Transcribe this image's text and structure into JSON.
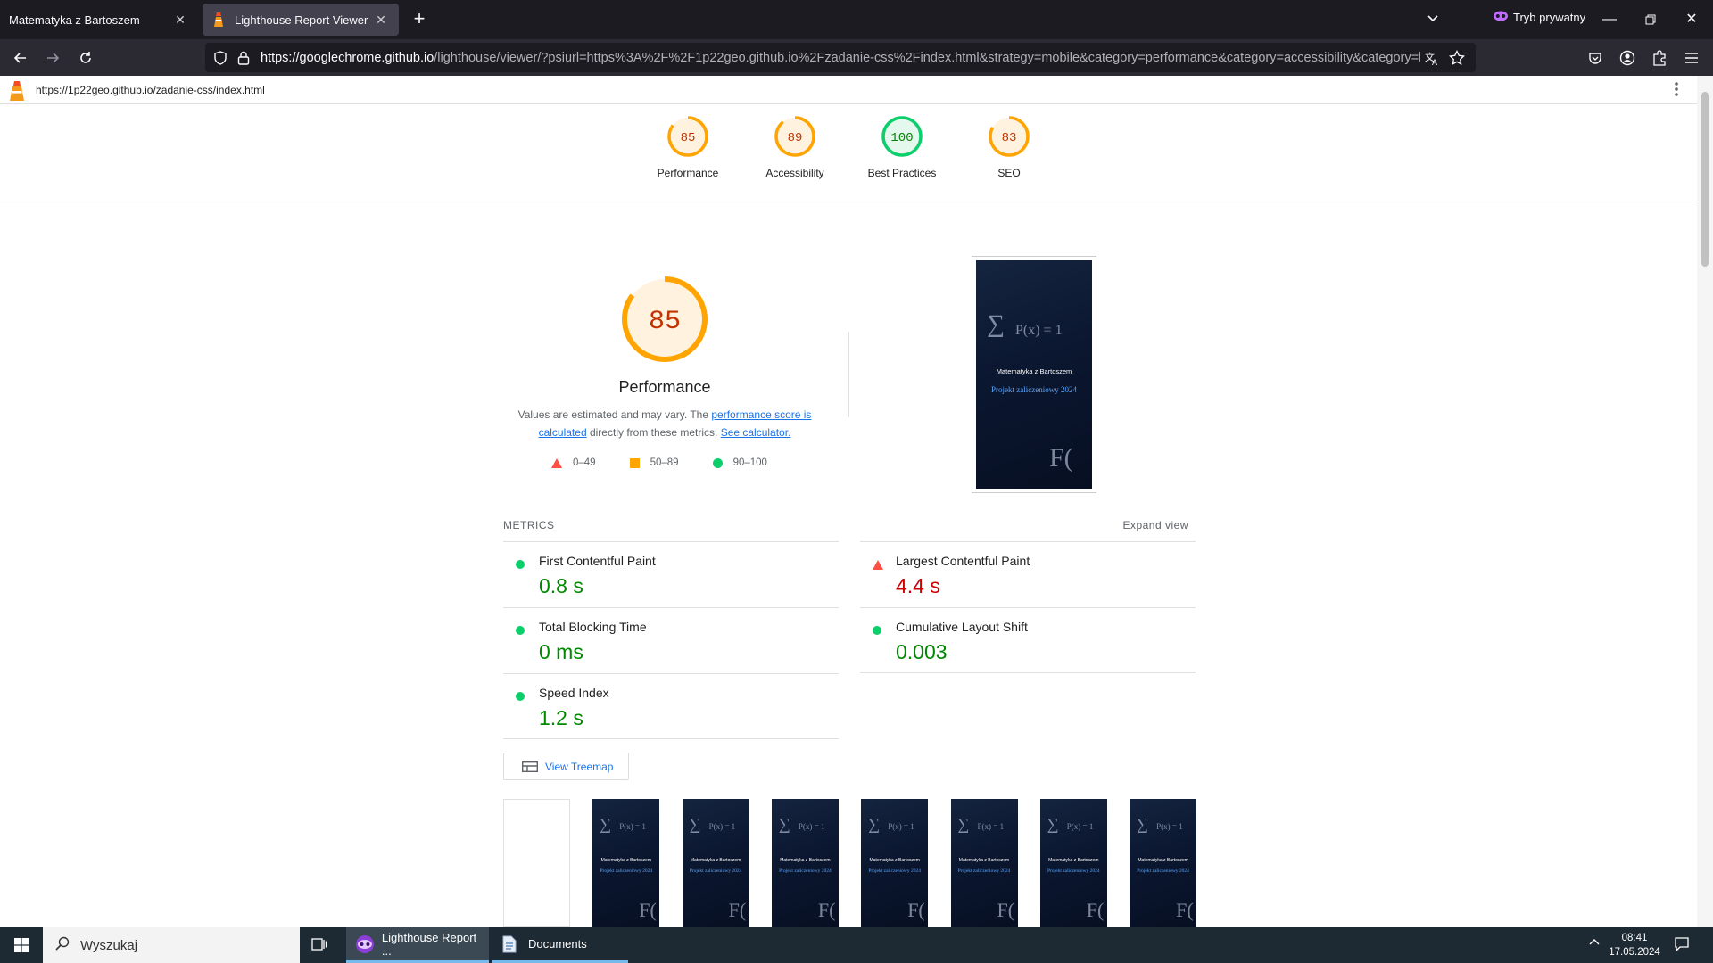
{
  "browser": {
    "tabs": [
      {
        "title": "Matematyka z Bartoszem",
        "active": false
      },
      {
        "title": "Lighthouse Report Viewer",
        "active": true
      }
    ],
    "private_label": "Tryb prywatny",
    "url_host": "https://googlechrome.github.io",
    "url_rest": "/lighthouse/viewer/?psiurl=https%3A%2F%2F1p22geo.github.io%2Fzadanie-css%2Findex.html&strategy=mobile&category=performance&category=accessibility&category=best-pra"
  },
  "report": {
    "page_url": "https://1p22geo.github.io/zadanie-css/index.html",
    "category_scores": [
      {
        "label": "Performance",
        "score": 85,
        "color": "#ffa400",
        "text_color": "#c33300"
      },
      {
        "label": "Accessibility",
        "score": 89,
        "color": "#ffa400",
        "text_color": "#c33300"
      },
      {
        "label": "Best Practices",
        "score": 100,
        "color": "#0cce6b",
        "text_color": "#008800"
      },
      {
        "label": "SEO",
        "score": 83,
        "color": "#ffa400",
        "text_color": "#c33300"
      }
    ],
    "performance": {
      "score": 85,
      "title": "Performance",
      "desc_1": "Values are estimated and may vary. The",
      "desc_link1": "performance score is calculated",
      "desc_2": "directly from these metrics.",
      "desc_link2": "See calculator."
    },
    "legend": [
      "0–49",
      "50–89",
      "90–100"
    ],
    "screenshot": {
      "site_name": "Matematyka z Bartoszem",
      "site_title": "Projekt zaliczeniowy 2024"
    },
    "metrics_heading": "METRICS",
    "expand_view": "Expand view",
    "metrics_left": [
      {
        "name": "First Contentful Paint",
        "value": "0.8 s",
        "status": "pass"
      },
      {
        "name": "Total Blocking Time",
        "value": "0 ms",
        "status": "pass"
      },
      {
        "name": "Speed Index",
        "value": "1.2 s",
        "status": "pass"
      }
    ],
    "metrics_right": [
      {
        "name": "Largest Contentful Paint",
        "value": "4.4 s",
        "status": "fail"
      },
      {
        "name": "Cumulative Layout Shift",
        "value": "0.003",
        "status": "pass"
      }
    ],
    "view_treemap": "View Treemap",
    "filmstrip_frames": 8
  },
  "taskbar": {
    "search_placeholder": "Wyszukaj",
    "apps": [
      {
        "label": "Lighthouse Report ..."
      },
      {
        "label": "Documents"
      }
    ],
    "time": "08:41",
    "date": "17.05.2024"
  },
  "colors": {
    "pass": "#0cce6b",
    "average": "#ffa400",
    "fail": "#ff4e42"
  }
}
